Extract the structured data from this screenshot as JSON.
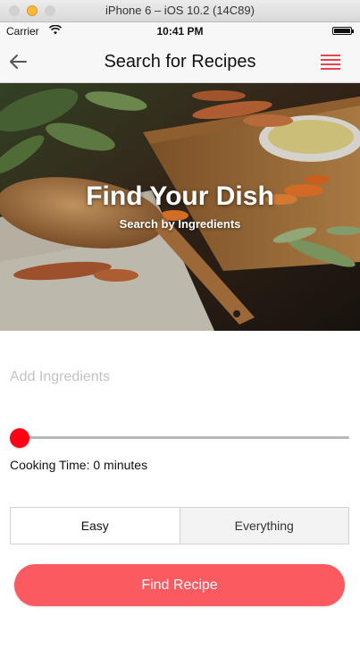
{
  "window": {
    "title": "iPhone 6 – iOS 10.2 (14C89)"
  },
  "status_bar": {
    "carrier": "Carrier",
    "time": "10:41 PM",
    "icons": [
      "wifi-icon",
      "battery-icon"
    ]
  },
  "nav": {
    "title": "Search for Recipes",
    "back_icon": "arrow-left-icon",
    "menu_icon": "hamburger-menu-icon"
  },
  "hero": {
    "title": "Find Your Dish",
    "subtitle": "Search by Ingredients"
  },
  "form": {
    "ingredients_placeholder": "Add Ingredients",
    "ingredients_value": "",
    "cooking_time_label": "Cooking Time: 0 minutes",
    "cooking_time_minutes": 0,
    "difficulty_options": [
      "Easy",
      "Everything"
    ],
    "find_button": "Find Recipe"
  },
  "colors": {
    "accent": "#fb5a60",
    "menu_icon": "#e8434b",
    "slider_thumb": "#ff0014"
  }
}
